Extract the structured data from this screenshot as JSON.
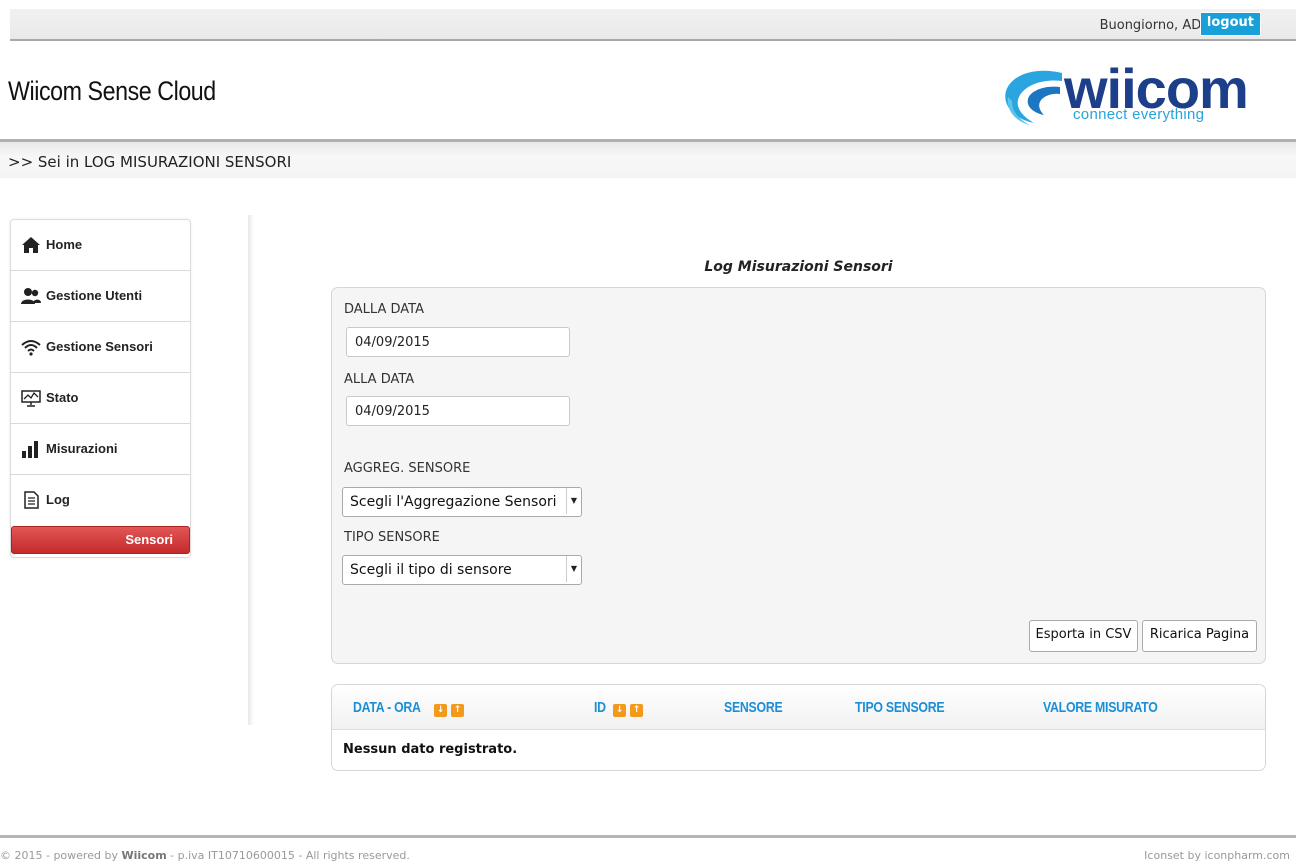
{
  "topbar": {
    "greeting": "Buongiorno,  ADMIN",
    "logout_label": "logout"
  },
  "header": {
    "app_title": "Wiicom Sense Cloud",
    "logo_word": "wiicom",
    "logo_tagline": "connect everything"
  },
  "breadcrumb": ">> Sei in LOG MISURAZIONI SENSORI",
  "sidebar": {
    "items": [
      {
        "label": "Home",
        "icon": "home-icon"
      },
      {
        "label": "Gestione Utenti",
        "icon": "users-icon"
      },
      {
        "label": "Gestione Sensori",
        "icon": "wifi-icon"
      },
      {
        "label": "Stato",
        "icon": "monitor-chart-icon"
      },
      {
        "label": "Misurazioni",
        "icon": "bar-chart-icon"
      },
      {
        "label": "Log",
        "icon": "document-icon"
      }
    ],
    "active_sub": "Sensori",
    "active_color": "#d03a3a"
  },
  "form": {
    "title": "Log Misurazioni Sensori",
    "from_label": "DALLA DATA",
    "from_value": "04/09/2015",
    "to_label": "ALLA DATA",
    "to_value": "04/09/2015",
    "aggreg_label": "AGGREG. SENSORE",
    "aggreg_selected": "Scegli l'Aggregazione Sensori",
    "type_label": "TIPO SENSORE",
    "type_selected": "Scegli il tipo di sensore",
    "export_label": "Esporta in CSV",
    "reload_label": "Ricarica Pagina"
  },
  "table": {
    "columns": [
      "DATA - ORA",
      "ID",
      "SENSORE",
      "TIPO SENSORE",
      "VALORE MISURATO"
    ],
    "header_color": "#1a8fd6",
    "sort_color": "#f39a1d",
    "empty_message": "Nessun dato registrato."
  },
  "footer": {
    "left_prefix": "© 2015 - powered by ",
    "left_brand": "Wiicom",
    "left_suffix": " - p.iva IT10710600015 - All rights reserved.",
    "right": "Iconset by iconpharm.com"
  }
}
